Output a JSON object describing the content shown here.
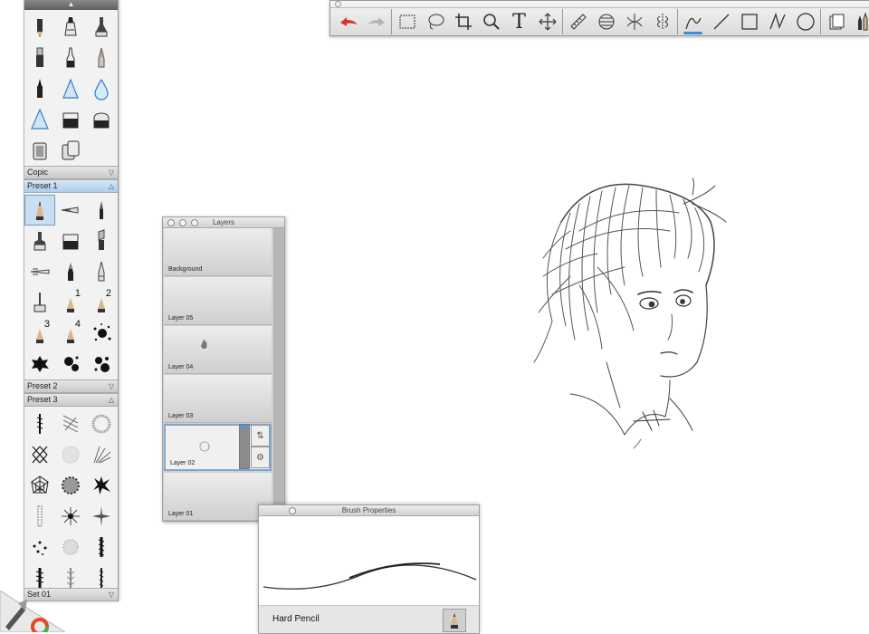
{
  "library": {
    "groups": {
      "copic": "Copic",
      "preset1": "Preset 1",
      "preset2": "Preset 2",
      "preset3": "Preset 3",
      "set": "Set 01"
    },
    "superscripts": [
      "1",
      "2",
      "3",
      "4"
    ]
  },
  "layers": {
    "title": "Layers",
    "items": [
      "Background",
      "Layer 05",
      "Layer 04",
      "Layer 03",
      "Layer 02",
      "Layer 01"
    ],
    "selected": "Layer 02"
  },
  "brush_properties": {
    "title": "Brush Properties",
    "brush_name": "Hard Pencil"
  },
  "toolbar": {
    "text_tool": "T"
  },
  "colors": {
    "accent": "#3b8de0",
    "selection": "#c9def0",
    "undo_arrow": "#d8302a"
  }
}
